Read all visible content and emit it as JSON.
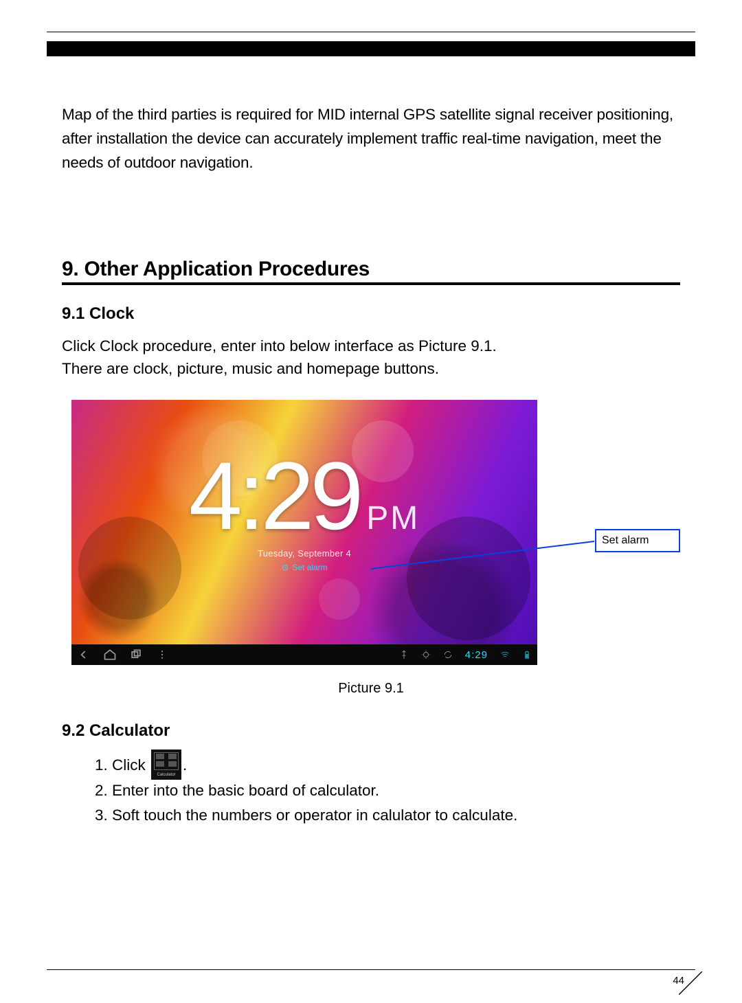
{
  "intro_paragraph": "Map of the third parties is required for MID internal GPS satellite signal receiver positioning, after installation the device can accurately implement traffic real-time navigation, meet the needs of outdoor navigation.",
  "section_heading": "9. Other Application Procedures",
  "clock_heading": "9.1 Clock",
  "clock_para_l1": "Click Clock procedure, enter into below interface as Picture 9.1.",
  "clock_para_l2": "There are clock, picture, music and homepage buttons.",
  "screenshot": {
    "time": "4:29",
    "period": "PM",
    "date": "Tuesday, September 4",
    "set_alarm_label": "Set alarm",
    "navbar_time": "4:29"
  },
  "callout_label": "Set alarm",
  "figure_caption": "Picture 9.1",
  "calc_heading": "9.2 Calculator",
  "calc_steps": {
    "s1_prefix": "1. Click",
    "s1_suffix": ".",
    "s2": "2. Enter into the basic board of calculator.",
    "s3": "3. Soft touch the numbers or operator in calulator to calculate."
  },
  "calc_icon_label": "Calculator",
  "page_number": "44"
}
